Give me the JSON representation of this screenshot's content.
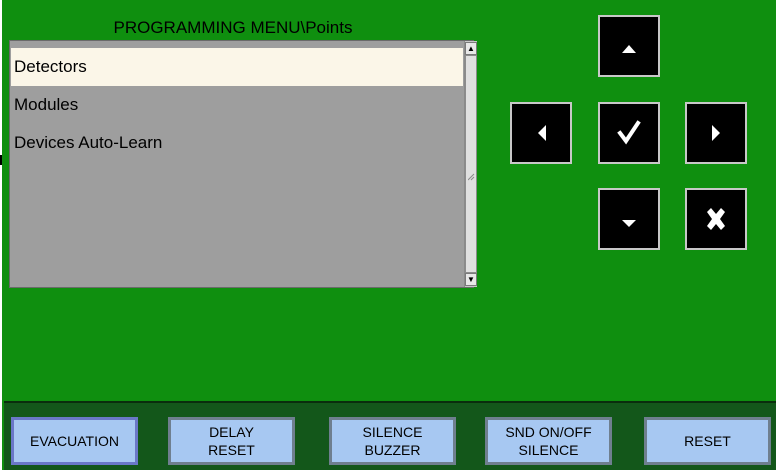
{
  "header": {
    "title": "PROGRAMMING MENU\\Points"
  },
  "menu": {
    "items": [
      {
        "label": "Detectors",
        "selected": true
      },
      {
        "label": "Modules",
        "selected": false
      },
      {
        "label": "Devices Auto-Learn",
        "selected": false
      }
    ],
    "scroll_up_icon": "scroll-up-arrow",
    "scroll_down_icon": "scroll-down-arrow"
  },
  "navigation": {
    "up_icon": "triangle-up",
    "left_icon": "triangle-left",
    "ok_icon": "checkmark",
    "right_icon": "triangle-right",
    "down_icon": "triangle-down",
    "cancel_icon": "x-mark"
  },
  "function_buttons": {
    "evacuation": {
      "line1": "EVACUATION",
      "line2": ""
    },
    "delay_reset": {
      "line1": "DELAY",
      "line2": "RESET"
    },
    "silence_buzzer": {
      "line1": "SILENCE",
      "line2": "BUZZER"
    },
    "snd_silence": {
      "line1": "SND ON/OFF",
      "line2": "SILENCE"
    },
    "reset": {
      "line1": "RESET",
      "line2": ""
    }
  },
  "colors": {
    "panel_green": "#0f8f0f",
    "bottom_bar": "#13571a",
    "list_background": "#9e9e9e",
    "selected_item": "#fbf6e8",
    "function_button": "#a7c8f2",
    "nav_button": "#000000"
  }
}
